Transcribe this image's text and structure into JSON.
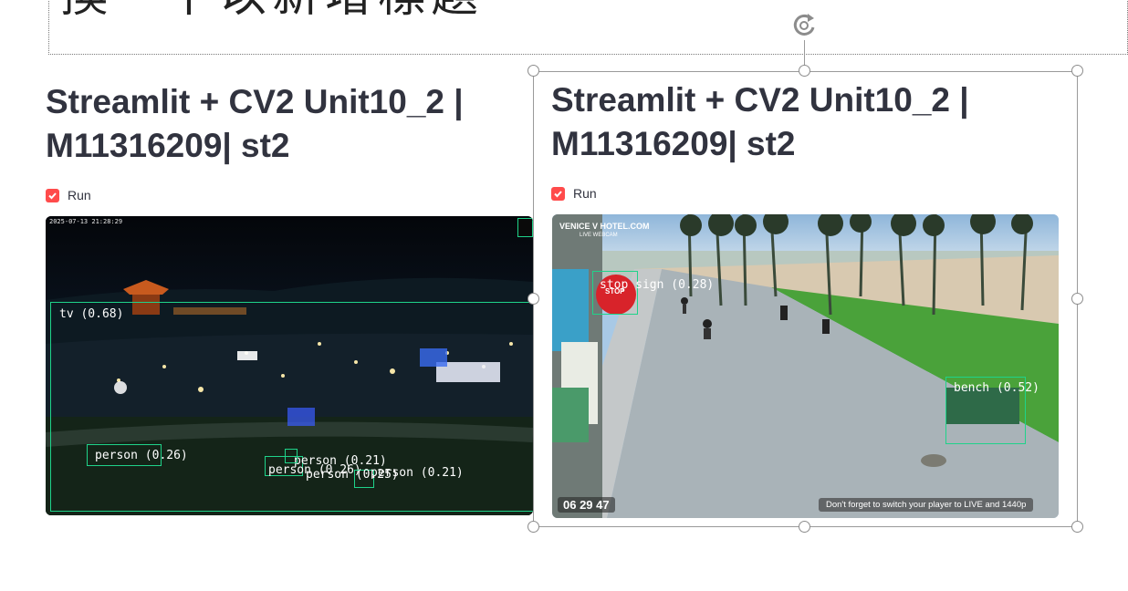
{
  "slide": {
    "title": "換一下以新增標題"
  },
  "panels": [
    {
      "app_title_line1": "Streamlit + CV2 Unit10_2 |",
      "app_title_line2": "M11316209| st2",
      "checkbox_label": "Run",
      "checkbox_checked": true,
      "video": {
        "timestamp": "2025-07-13 21:28:29",
        "detections": [
          {
            "label": "tv (0.68)"
          },
          {
            "label": "person (0.26)"
          },
          {
            "label": "person (0.21)"
          },
          {
            "label": "person (0.26)"
          },
          {
            "label": "person (0.25)"
          },
          {
            "label": "person (0.21)"
          }
        ]
      }
    },
    {
      "app_title_line1": "Streamlit + CV2 Unit10_2 |",
      "app_title_line2": "M11316209| st2",
      "checkbox_label": "Run",
      "checkbox_checked": true,
      "video": {
        "cam_logo": "VENICE V HOTEL.COM",
        "cam_sublogo": "LIVE WEBCAM",
        "sign_text": "STOP",
        "clock": "06 29 47",
        "notice": "Don't forget to switch your player to LIVE and 1440p",
        "detections": [
          {
            "label": "stop sign (0.28)"
          },
          {
            "label": "bench (0.52)"
          }
        ]
      }
    }
  ],
  "colors": {
    "checkbox": "#ff4b4b",
    "title_text": "#31333f",
    "detection_box": "#1fd38a",
    "selection_frame": "#9a9a9a"
  },
  "icons": [
    "rotate-icon",
    "checkmark-icon",
    "selection-handle"
  ]
}
